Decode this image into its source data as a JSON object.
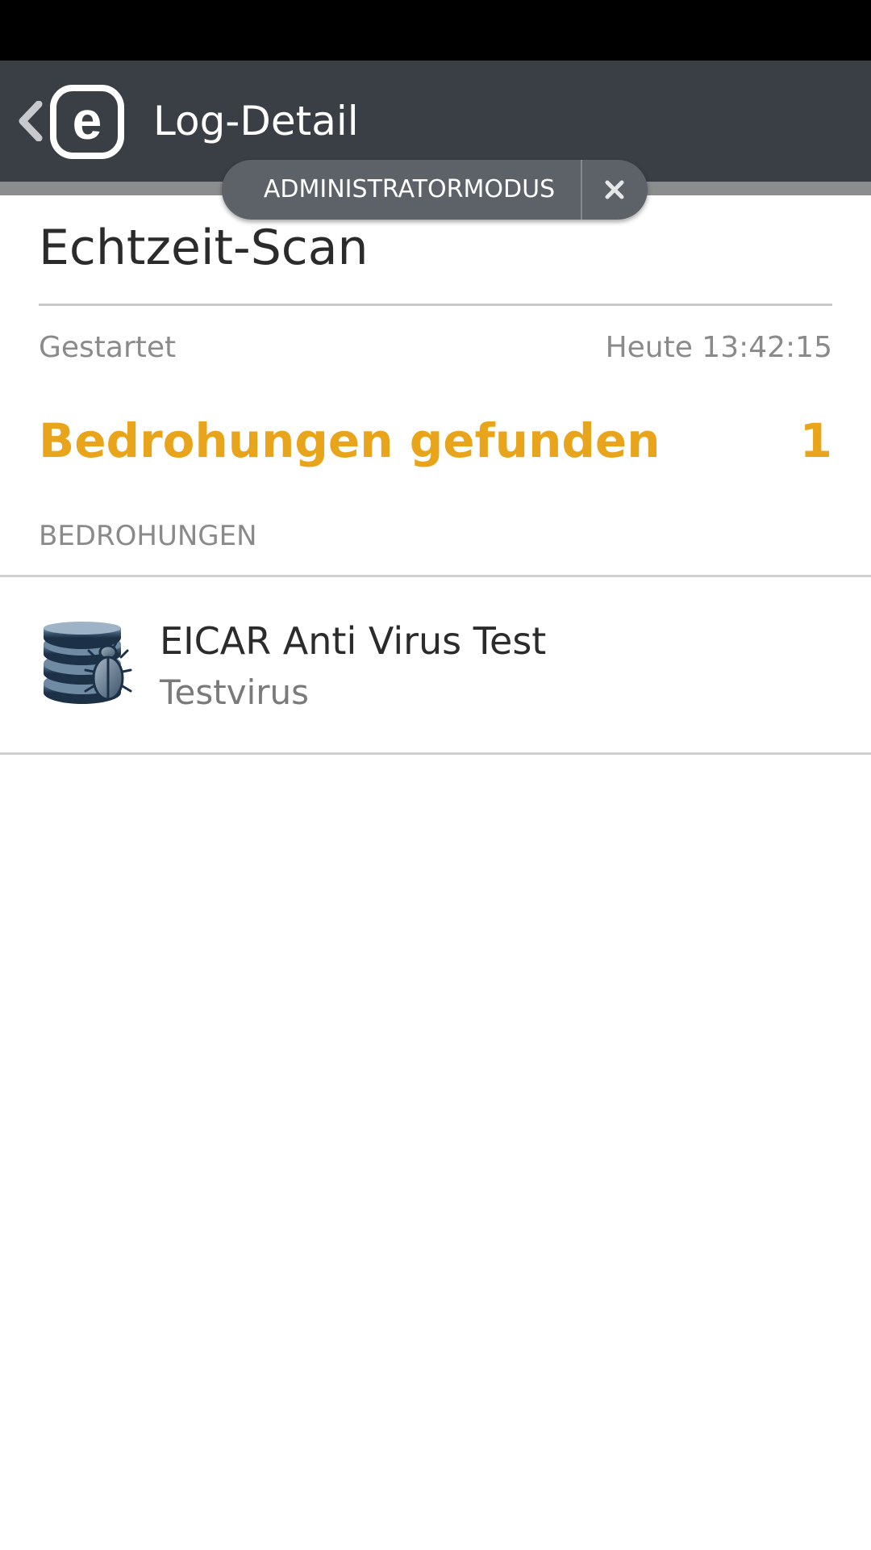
{
  "header": {
    "title": "Log-Detail",
    "back_icon": "chevron-left-icon",
    "logo_icon": "eset-logo-icon",
    "logo_letter": "e",
    "bar_color": "#3a3e45"
  },
  "admin_mode": {
    "label": "ADMINISTRATORMODUS",
    "close_icon": "close-icon"
  },
  "scan": {
    "title": "Echtzeit-Scan",
    "started_label": "Gestartet",
    "started_value": "Heute 13:42:15",
    "threats_label": "Bedrohungen gefunden",
    "threats_count": "1",
    "accent_color": "#e8a51b"
  },
  "threats_section": {
    "header": "BEDROHUNGEN",
    "items": [
      {
        "name": "EICAR Anti Virus Test",
        "type": "Testvirus",
        "icon": "virus-database-bug-icon"
      }
    ]
  }
}
